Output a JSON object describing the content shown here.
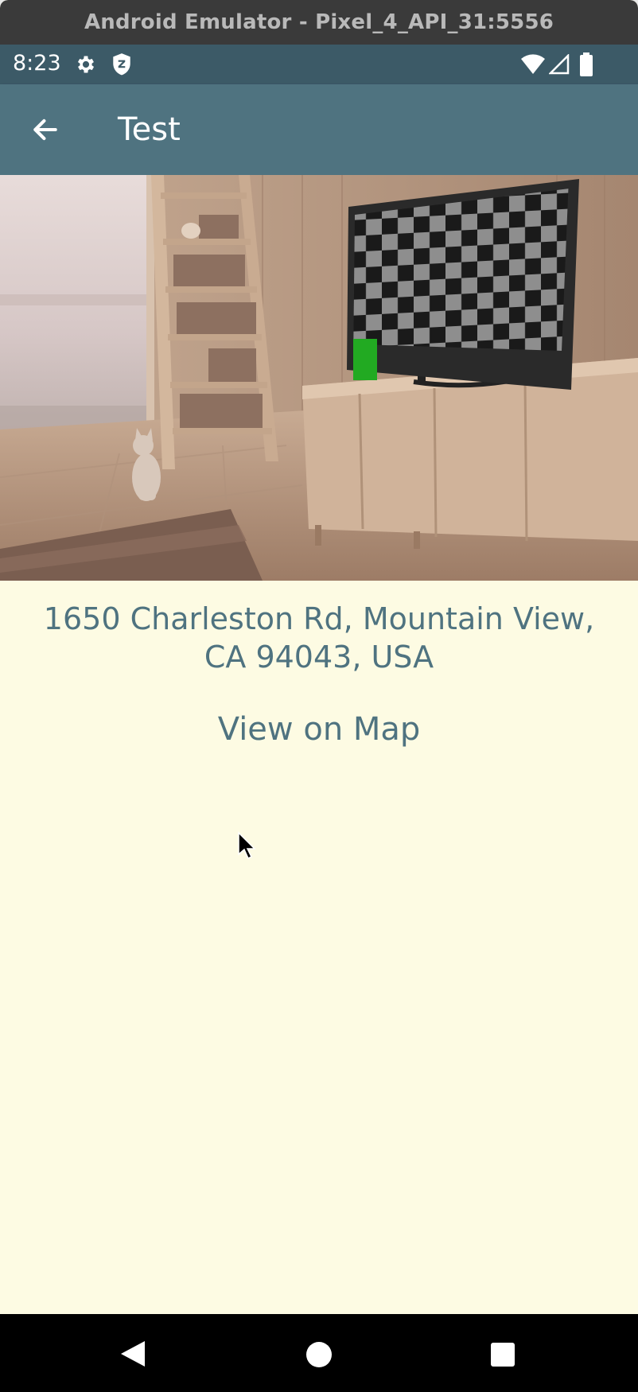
{
  "window": {
    "title": "Android Emulator - Pixel_4_API_31:5556"
  },
  "status_bar": {
    "time": "8:23",
    "icons": [
      "gear-icon",
      "shield-icon",
      "wifi-icon",
      "signal-icon",
      "battery-icon"
    ]
  },
  "app_bar": {
    "title": "Test",
    "back_icon": "arrow-left-icon",
    "color": "#4f7380"
  },
  "photo": {
    "subject": "living room with TV showing checkerboard test pattern, bookshelf ladder and cat"
  },
  "content": {
    "address": "1650 Charleston Rd, Mountain View, CA 94043, USA",
    "map_link": "View on Map",
    "text_color": "#4f7380",
    "background": "#fdfbe3"
  },
  "nav_bar": {
    "buttons": [
      "back-triangle-icon",
      "home-circle-icon",
      "recents-square-icon"
    ]
  }
}
